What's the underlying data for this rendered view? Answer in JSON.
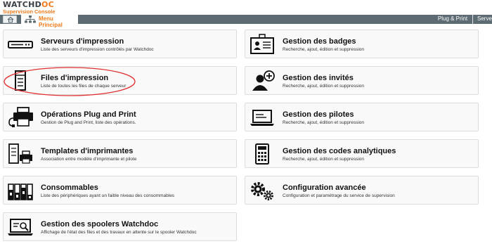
{
  "header": {
    "logo_a": "WATCHD",
    "logo_oc": "OC",
    "logo_sub": "Supervision Console"
  },
  "nav": {
    "menu_label": "Menu Principal",
    "plug_print": "Plug & Print",
    "serve": "Serve"
  },
  "cards": [
    {
      "title": "Serveurs d'impression",
      "desc": "Liste des serveurs d'impression contrôlés par Watchdoc",
      "icon": "server-icon"
    },
    {
      "title": "Gestion des badges",
      "desc": "Recherche, ajout, édition et suppression",
      "icon": "badge-icon"
    },
    {
      "title": "Files d'impression",
      "desc": "Liste de toutes les files de chaque serveur",
      "icon": "printer-tower-icon"
    },
    {
      "title": "Gestion des invités",
      "desc": "Recherche, ajout, édition et suppression",
      "icon": "add-guest-icon"
    },
    {
      "title": "Opérations Plug and Print",
      "desc": "Gestion de Plug and Print, liste des opérations.",
      "icon": "plug-printer-icon"
    },
    {
      "title": "Gestion des pilotes",
      "desc": "Recherche, ajout, édition et suppression",
      "icon": "laptop-icon"
    },
    {
      "title": "Templates d'imprimantes",
      "desc": "Association entre modèle d'imprimante et pilote",
      "icon": "printer-template-icon"
    },
    {
      "title": "Gestion des codes analytiques",
      "desc": "Recherche, ajout, édition et suppression",
      "icon": "calculator-icon"
    },
    {
      "title": "Consommables",
      "desc": "Liste des périphériques ayant un faible niveau des consommables",
      "icon": "toner-icon"
    },
    {
      "title": "Configuration avancée",
      "desc": "Configuration et paramétrage du service de supervision",
      "icon": "gears-icon"
    },
    {
      "title": "Gestion des spoolers Watchdoc",
      "desc": "Affichage de l'état des files et des travaux en attente sur le spooler Watchdoc",
      "icon": "spooler-icon"
    }
  ],
  "colors": {
    "accent": "#f07a1a",
    "navbar": "#5d6b72",
    "highlight": "#e03030"
  }
}
